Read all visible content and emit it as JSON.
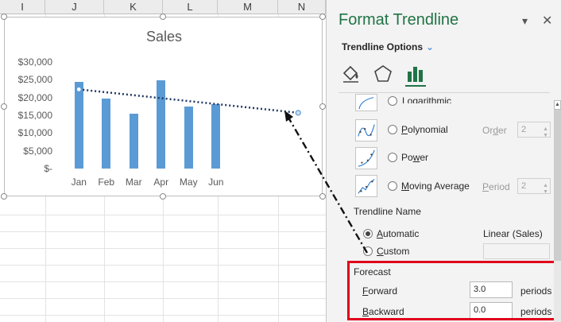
{
  "sheet": {
    "columns": [
      "I",
      "J",
      "K",
      "L",
      "M",
      "N"
    ]
  },
  "chart_data": {
    "type": "bar",
    "title": "Sales",
    "categories": [
      "Jan",
      "Feb",
      "Mar",
      "Apr",
      "May",
      "Jun"
    ],
    "values": [
      24500,
      19800,
      15400,
      24800,
      17500,
      18200
    ],
    "ylim": [
      0,
      30000
    ],
    "yticks": [
      {
        "value": 0,
        "label": "$-"
      },
      {
        "value": 5000,
        "label": "$5,000"
      },
      {
        "value": 10000,
        "label": "$10,000"
      },
      {
        "value": 15000,
        "label": "$15,000"
      },
      {
        "value": 20000,
        "label": "$20,000"
      },
      {
        "value": 25000,
        "label": "$25,000"
      },
      {
        "value": 30000,
        "label": "$30,000"
      }
    ],
    "trendline": {
      "type": "linear",
      "start": {
        "x": 1,
        "y": 22300
      },
      "end": {
        "x": 9,
        "y": 15700
      }
    },
    "gridlines": false,
    "color": "#5b9bd5"
  },
  "pane": {
    "title": "Format Trendline",
    "dropdown_icon": "caret-down-icon",
    "close_icon": "close-icon",
    "section": "Trendline Options",
    "tabs": [
      "fill-line-icon",
      "effects-icon",
      "trendline-options-icon"
    ],
    "types": [
      {
        "label": "Logarithmic",
        "param_label": "",
        "param_value": ""
      },
      {
        "label": "Polynomial",
        "param_label": "Order",
        "param_value": "2"
      },
      {
        "label": "Power",
        "param_label": "",
        "param_value": ""
      },
      {
        "label": "Moving Average",
        "param_label": "Period",
        "param_value": "2"
      }
    ],
    "name_heading": "Trendline Name",
    "name_automatic": "Automatic",
    "name_auto_value": "Linear (Sales)",
    "name_custom": "Custom",
    "forecast_heading": "Forecast",
    "forward_label": "Forward",
    "forward_value": "3.0",
    "forward_unit": "periods",
    "backward_label": "Backward",
    "backward_value": "0.0",
    "backward_unit": "periods",
    "accent_color": "#217346",
    "highlight_color": "#e0001b"
  }
}
